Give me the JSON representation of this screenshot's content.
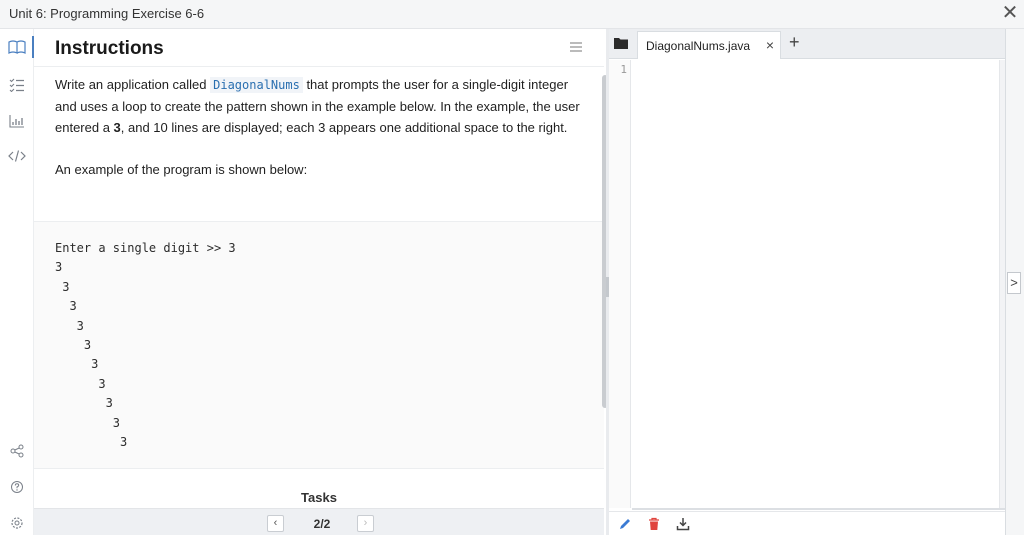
{
  "window": {
    "title": "Unit 6: Programming Exercise 6-6",
    "close_label": "✕"
  },
  "rail": {
    "items": [
      {
        "name": "instructions-icon"
      },
      {
        "name": "tasks-icon"
      },
      {
        "name": "results-chart-icon"
      },
      {
        "name": "code-icon"
      },
      {
        "name": "share-icon"
      },
      {
        "name": "help-icon"
      },
      {
        "name": "settings-icon"
      }
    ],
    "accent": "#4a7fc0"
  },
  "instructions": {
    "heading": "Instructions",
    "para1_before": "Write an application called ",
    "para1_code": "DiagonalNums",
    "para1_mid": " that prompts the user for a single-digit integer and uses a loop to create the pattern shown in the example below. In the example, the user entered a ",
    "para1_bold": "3",
    "para1_after": ", and 10 lines are displayed; each 3 appears one additional space to the right.",
    "para2": "An example of the program is shown below:",
    "example_output": "Enter a single digit >> 3\n3\n 3\n  3\n   3\n    3\n     3\n      3\n       3\n        3\n         3"
  },
  "tasks": {
    "label": "Tasks",
    "prev_label": "‹",
    "next_label": "›",
    "counter": "2/2"
  },
  "editor": {
    "tab_filename": "DiagonalNums.java",
    "tab_close": "×",
    "new_tab": "+",
    "line_number": "1",
    "expand_label": ">",
    "icon_colors": {
      "pencil": "#3b7bd4",
      "trash": "#e0443e",
      "download": "#444444"
    }
  }
}
